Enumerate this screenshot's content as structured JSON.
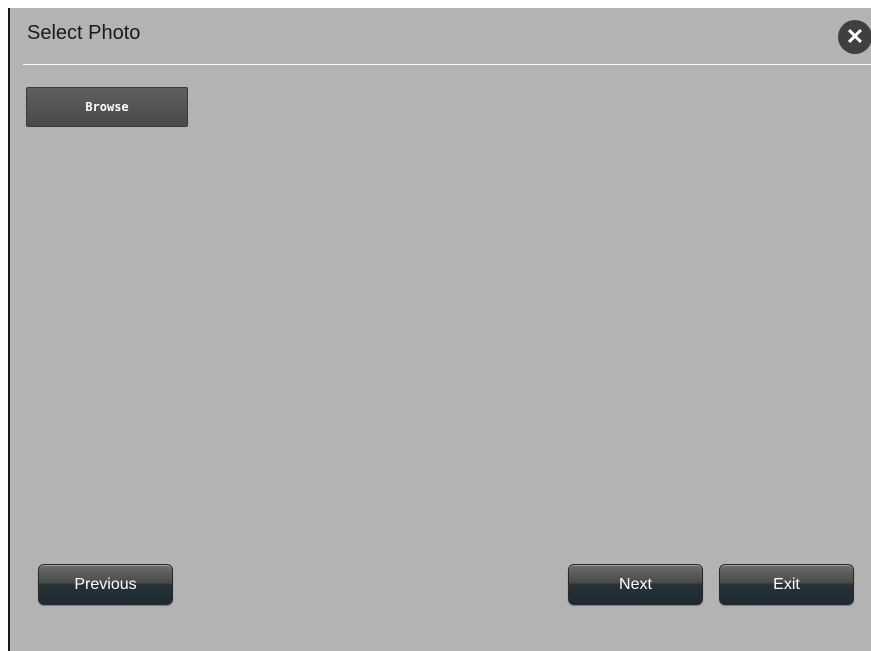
{
  "dialog": {
    "title": "Select Photo",
    "close_icon": "close-icon",
    "close_glyph": "✕"
  },
  "upload": {
    "browse_label": "Browse"
  },
  "footer": {
    "previous_label": "Previous",
    "next_label": "Next",
    "exit_label": "Exit"
  },
  "colors": {
    "dialog_background": "#b3b3b3",
    "button_dark": "#1c2a33",
    "browse_button": "#555555",
    "close_button": "#3f3f3f"
  }
}
